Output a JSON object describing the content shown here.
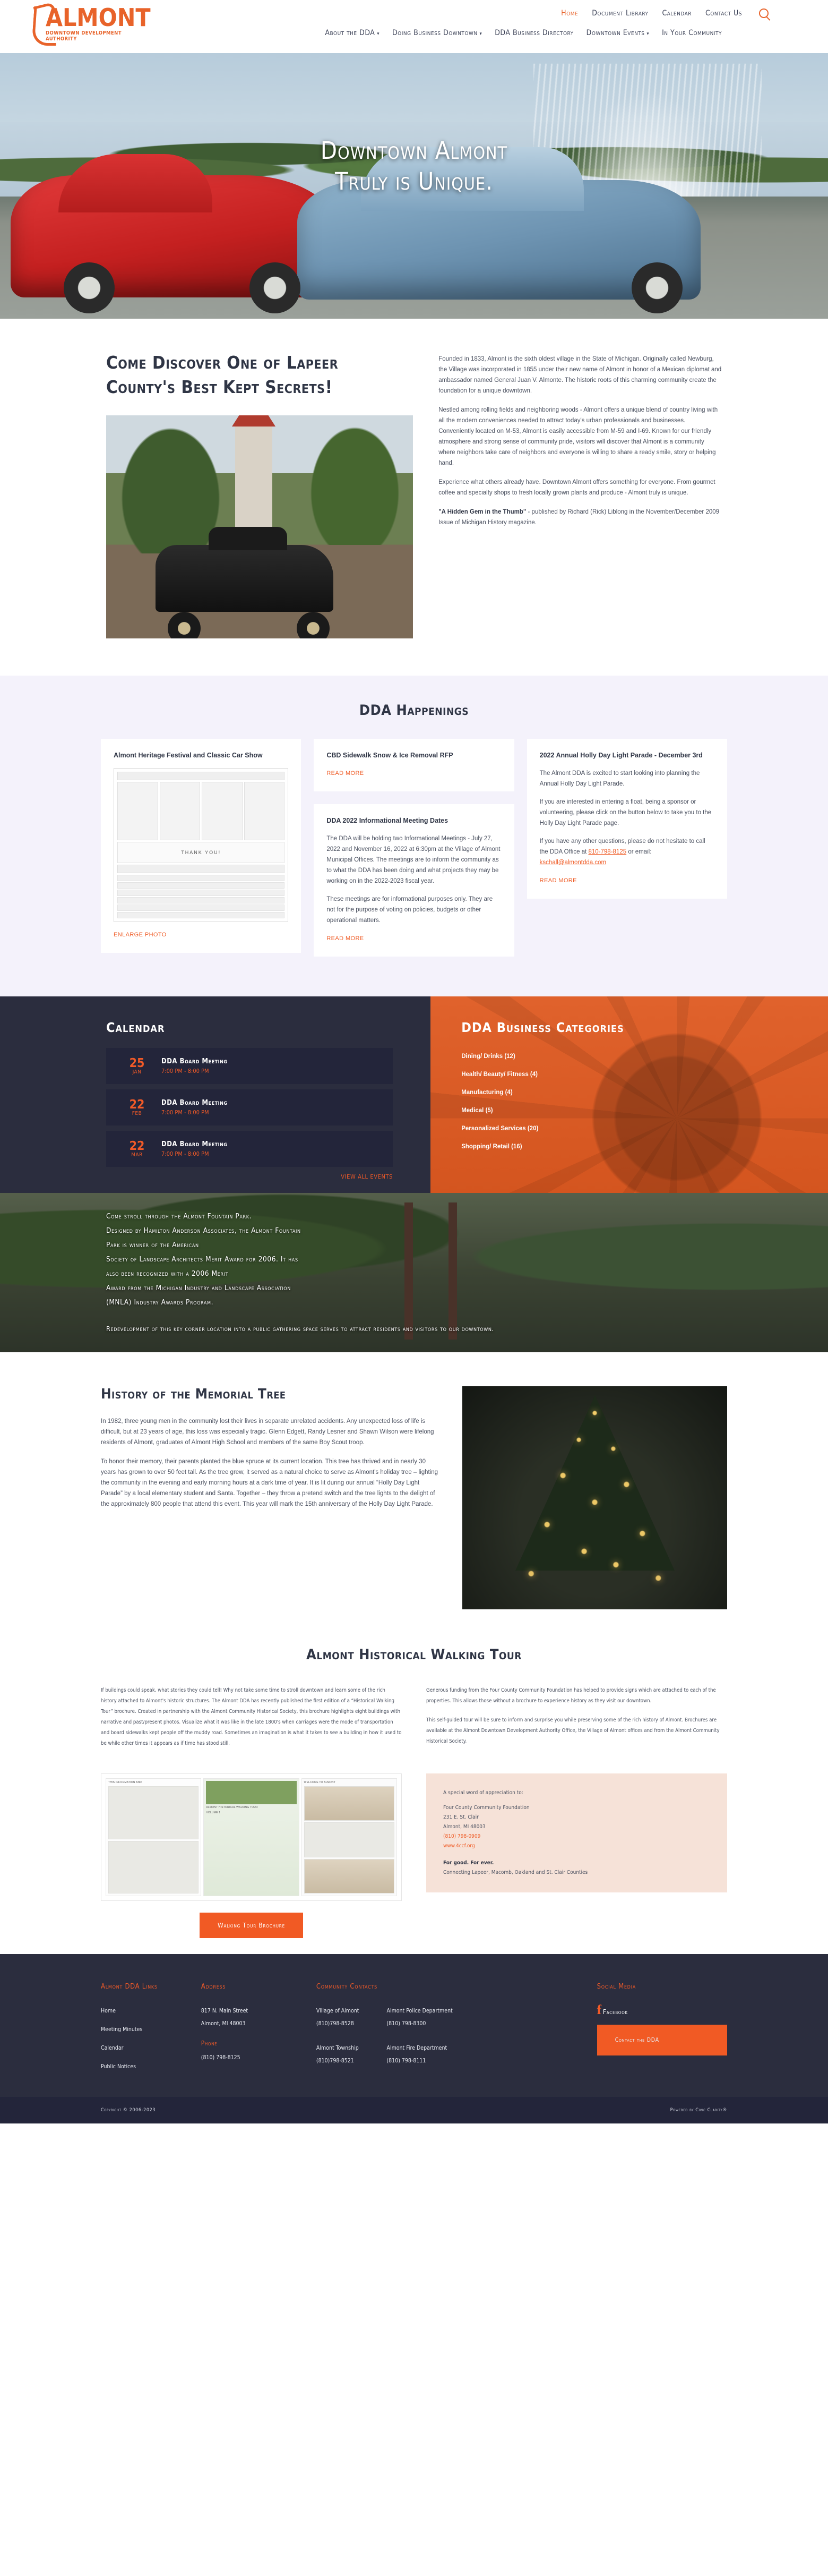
{
  "header": {
    "logo_text": "ALMONT",
    "logo_sub": "DOWNTOWN DEVELOPMENT AUTHORITY",
    "top_nav": [
      {
        "label": "Home",
        "active": true
      },
      {
        "label": "Document Library",
        "active": false
      },
      {
        "label": "Calendar",
        "active": false
      },
      {
        "label": "Contact Us",
        "active": false
      }
    ],
    "search_icon": "search-icon",
    "main_nav": [
      {
        "label": "About the DDA",
        "caret": "▾"
      },
      {
        "label": "Doing Business Downtown",
        "caret": "▾"
      },
      {
        "label": "DDA Business Directory",
        "caret": ""
      },
      {
        "label": "Downtown Events",
        "caret": "▾"
      },
      {
        "label": "In Your Community",
        "caret": ""
      }
    ]
  },
  "hero": {
    "line1": "Downtown Almont",
    "line2": "Truly is Unique."
  },
  "intro": {
    "title_line1": "Come Discover One of Lapeer",
    "title_line2": "County's Best Kept Secrets!",
    "p1": "Founded in 1833, Almont is the sixth oldest village in the State of Michigan. Originally called Newburg, the Village was incorporated\nin 1855 under their new name of Almont in honor of a Mexican diplomat and ambassador named General Juan V. Almonte.\nThe historic roots of this charming community create the foundation for a unique downtown.",
    "p2": "Nestled among rolling fields and neighboring woods - Almont offers a unique blend of country living with all the modern conveniences needed to attract today's urban professionals and businesses. Conveniently located on M-53, Almont is easily accessible from M-59 and I-69. Known for our friendly atmosphere and strong sense of community pride, visitors will discover that Almont is a community where neighbors take care of neighbors and everyone is willing to share a ready smile, story or helping hand.",
    "p3": "Experience what others already have. Downtown Almont offers something for everyone. From gourmet coffee and specialty shops to fresh locally grown plants and produce - Almont truly is unique.",
    "p4_bold": "\"A Hidden Gem in the Thumb\"",
    "p4_rest": " - published by Richard (Rick) Liblong in the November/December 2009 Issue of Michigan History magazine."
  },
  "happenings": {
    "title": "DDA Happenings",
    "card1": {
      "heading": "Almont Heritage Festival and Classic Car Show",
      "flyer_text": "THANK YOU!",
      "enlarge_label": "ENLARGE PHOTO"
    },
    "card2": {
      "heading": "CBD Sidewalk Snow & Ice Removal RFP",
      "read_more": "READ MORE"
    },
    "card3": {
      "heading": "DDA 2022 Informational Meeting Dates",
      "body1": "The DDA will be holding two Informational Meetings - July 27, 2022 and November 16, 2022 at 6:30pm  at the Village of Almont Municipal Offices.  The meetings are to inform the community as to what the DDA has been doing and what projects they may be working on in the 2022-2023 fiscal year.",
      "body2": "These meetings are for informational purposes only.  They are not for the purpose of voting on policies, budgets or other operational matters.",
      "read_more": "READ MORE"
    },
    "card4": {
      "heading": "2022 Annual Holly Day Light Parade - December 3rd",
      "body1": "The Almont DDA is excited to start looking into planning the Annual Holly Day Light Parade.",
      "body2": "If you are interested in entering a float, being a sponsor or volunteering, please click on the button below to take you to the Holly Day Light Parade page.",
      "body3_pre": "If you have any other questions, please do not hesitate to call the DDA Office at ",
      "phone": "810-798-8125",
      "body3_mid": " or email: ",
      "email": "kschall@almontdda.com",
      "read_more": "READ MORE"
    }
  },
  "calendar": {
    "title": "Calendar",
    "events": [
      {
        "day": "25",
        "month": "JAN",
        "title": "DDA Board Meeting",
        "time": "7:00 PM - 8:00 PM"
      },
      {
        "day": "22",
        "month": "FEB",
        "title": "DDA Board Meeting",
        "time": "7:00 PM - 8:00 PM"
      },
      {
        "day": "22",
        "month": "MAR",
        "title": "DDA Board Meeting",
        "time": "7:00 PM - 8:00 PM"
      }
    ],
    "view_all": "VIEW ALL EVENTS"
  },
  "business_categories": {
    "title": "DDA Business Categories",
    "items": [
      "Dining/ Drinks (12)",
      "Health/ Beauty/ Fitness (4)",
      "Manufacturing (4)",
      "Medical (5)",
      "Personalized Services (20)",
      "Shopping/ Retail (16)"
    ]
  },
  "fountain_banner": {
    "lines": [
      "Come stroll through the Almont Fountain Park.",
      "Designed by Hamilton Anderson Associates, the Almont Fountain",
      "Park is winner of the American",
      "Society of Landscape Architects Merit Award for 2006. It has",
      "also been recognized with a 2006 Merit",
      "Award from the Michigan Industry and Landscape Association",
      "(MNLA) Industry Awards Program."
    ],
    "last_line": "Redevelopment of this key corner location into a public gathering space serves to attract residents and visitors to our downtown."
  },
  "memorial": {
    "title": "History of the Memorial Tree",
    "p1": "In 1982, three young men in the community lost their lives in separate unrelated accidents.  Any unexpected loss of life is difficult, but at 23 years of age, this loss was especially tragic.  Glenn Edgett, Randy Lesner and Shawn Wilson were lifelong residents of Almont, graduates of Almont High School and members of the same Boy Scout troop.",
    "p2": "To honor their memory, their parents planted the blue spruce at its current location.  This tree has thrived and in nearly 30 years has grown to over 50 feet tall.  As the tree grew, it served as a natural choice to serve as Almont's holiday tree – lighting the community in the evening and early morning hours at a dark time of year. It is lit during our annual “Holly Day Light Parade” by a local elementary student and Santa.  Together – they throw a pretend switch and the tree lights to the delight of the approximately 800 people that attend this event.  This year will mark the 15th anniversary of the Holly Day Light Parade."
  },
  "walking_tour": {
    "title": "Almont Historical Walking Tour",
    "left_p1": "If buildings could speak, what stories they could tell! Why not take some time to stroll downtown and learn some of the rich history attached to Almont's historic structures. The Almont DDA has recently published the first edition of a “Historical Walking Tour” brochure. Created in partnership with the Almont Community Historical Society, this brochure highlights eight buildings with narrative and past/present photos. Visualize what it was like in the late 1800's when carriages were the mode of transportation and board sidewalks kept people off the muddy road. Sometimes an imagination is what it takes to see a building in how it used to be while other times it appears as if time has stood still.",
    "right_p1": "Generous funding from the Four County Community Foundation has helped to provide signs which are attached to each of the\nproperties. This allows those without a brochure to experience history as they visit our downtown.",
    "right_p2": "This self-guided tour will be sure to inform and surprise you while preserving some of the rich history of Almont. Brochures are available at the Almont Downtown Development Authority Office, the Village of Almont offices and from the Almont Community Historical Society.",
    "brochure_label_welcome": "WELCOME TO ALMONT",
    "brochure_label_title": "ALMONT HISTORICAL WALKING TOUR",
    "brochure_label_vol": "VOLUME 1",
    "brochure_label_info": "THIS INFORMATION AND",
    "button": "Walking Tour Brochure",
    "thanks": {
      "line1": "A special word of appreciation to:",
      "line2": "Four County Community Foundation",
      "line3": "231 E. St. Clair",
      "line4": "Almont, MI 48003",
      "phone": "(810) 798-0909",
      "website": "www.4ccf.org",
      "forgood": "For good. For ever.",
      "tagline": "Connecting Lapeer, Macomb, Oakland and St. Clair Counties"
    }
  },
  "footer": {
    "links": {
      "heading": "Almont DDA Links",
      "items": [
        "Home",
        "Meeting Minutes",
        "Calendar",
        "Public Notices"
      ]
    },
    "address": {
      "heading": "Address",
      "line1": "817 N. Main Street",
      "line2": "Almont, MI 48003",
      "phone_heading": "Phone",
      "phone": "(810) 798-8125"
    },
    "contacts": {
      "heading": "Community Contacts",
      "items": [
        {
          "name": "Village of Almont",
          "phone": "(810)798-8528"
        },
        {
          "name": "Almont Police Department",
          "phone": "(810) 798-8300"
        },
        {
          "name": "Almont Township",
          "phone": "(810)798-8521"
        },
        {
          "name": "Almont Fire Department",
          "phone": "(810) 798-8111"
        }
      ]
    },
    "social": {
      "heading": "Social Media",
      "facebook_label": "Facebook",
      "facebook_icon": "facebook-icon",
      "contact_button": "Contact the DDA"
    }
  },
  "copyright": {
    "left": "Copyright © 2006-2023",
    "right": "Powered by Civic Clarity®"
  }
}
